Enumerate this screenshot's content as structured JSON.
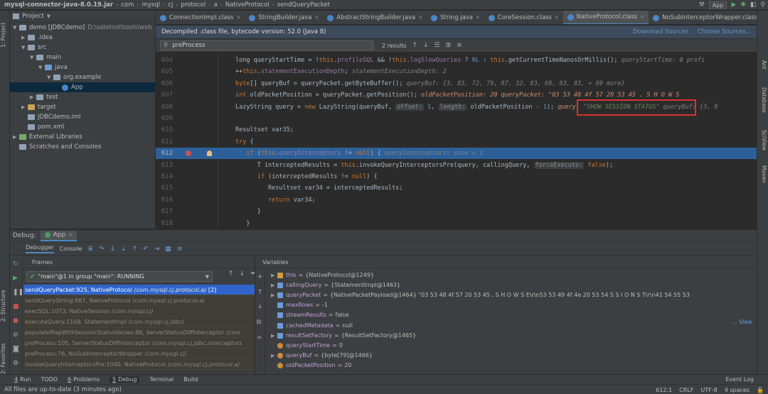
{
  "breadcrumbs": [
    "mysql-connector-java-8.0.19.jar",
    "com",
    "mysql",
    "cj",
    "protocol",
    "a",
    "NativeProtocol",
    "sendQueryPacket"
  ],
  "run_config": "App",
  "left_tabs": [
    "1: Project",
    "2: Structure",
    "2: Favorites"
  ],
  "right_tabs": [
    "Ant",
    "Database",
    "SciView",
    "Maven"
  ],
  "project": {
    "header": "Project",
    "tree": [
      {
        "label": "demo [JDBCdemo]",
        "extra": "D:\\satetool\\tools\\web",
        "depth": 0,
        "open": true,
        "kind": "module"
      },
      {
        "label": ".idea",
        "depth": 1,
        "open": false,
        "kind": "folder"
      },
      {
        "label": "src",
        "depth": 1,
        "open": true,
        "kind": "folder"
      },
      {
        "label": "main",
        "depth": 2,
        "open": true,
        "kind": "folder"
      },
      {
        "label": "java",
        "depth": 3,
        "open": true,
        "kind": "source"
      },
      {
        "label": "org.example",
        "depth": 4,
        "open": true,
        "kind": "package"
      },
      {
        "label": "App",
        "depth": 5,
        "open": null,
        "kind": "class",
        "selected": true
      },
      {
        "label": "test",
        "depth": 2,
        "open": false,
        "kind": "folder"
      },
      {
        "label": "target",
        "depth": 1,
        "open": false,
        "kind": "excluded"
      },
      {
        "label": "JDBCdemo.iml",
        "depth": 1,
        "open": null,
        "kind": "file"
      },
      {
        "label": "pom.xml",
        "depth": 1,
        "open": null,
        "kind": "file"
      },
      {
        "label": "External Libraries",
        "depth": 0,
        "open": false,
        "kind": "lib"
      },
      {
        "label": "Scratches and Consoles",
        "depth": 0,
        "open": null,
        "kind": "scratch"
      }
    ]
  },
  "editor_tabs": [
    {
      "label": "ConnectionImpl.class",
      "icon": "class-icon",
      "active": false
    },
    {
      "label": "StringBuilder.java",
      "icon": "class-icon",
      "active": false
    },
    {
      "label": "AbstractStringBuilder.java",
      "icon": "class-icon",
      "active": false
    },
    {
      "label": "String.java",
      "icon": "class-icon",
      "active": false
    },
    {
      "label": "CoreSession.class",
      "icon": "class-icon",
      "active": false
    },
    {
      "label": "NativeProtocol.class",
      "icon": "class-icon",
      "active": true
    },
    {
      "label": "NoSubInterceptorWrapper.class",
      "icon": "class-icon",
      "active": false
    }
  ],
  "banner": {
    "text": "Decompiled .class file, bytecode version: 52.0 (Java 8)",
    "download": "Download Sources",
    "choose": "Choose Sources..."
  },
  "find": {
    "value": "preProcess",
    "results": "2 results"
  },
  "code_lines": [
    {
      "num": "604",
      "html": "long queryStartTime = !<span class='kw'>this</span>.<span class='fld'>profileSQL</span> &amp;&amp; !<span class='kw'>this</span>.<span class='fld'>logSlowQueries</span> ? <span class='num'>0L</span> : <span class='kw'>this</span>.getCurrentTimeNanosOrMillis();   <span class='inl'>queryStartTime: 0  profi</span>"
    },
    {
      "num": "605",
      "html": "++<span class='kw'>this</span>.<span class='fld'>statementExecutionDepth</span>;  <span class='inl'>statementExecutionDepth: 2</span>"
    },
    {
      "num": "606",
      "html": "<span class='kw'>byte</span>[] queryBuf = queryPacket.getByteBuffer();  <span class='inl'>queryBuf: {3, 83, 72, 79, 87, 32, 83, 69, 83, 83, + 69 more}</span>"
    },
    {
      "num": "607",
      "html": "<span class='kw'>int</span> oldPacketPosition = queryPacket.getPosition();  <span class='inl2'>oldPacketPosition: 20  queryPacket: \"03 53 48 4f 57 20 53 45    . S H O W  S</span>"
    },
    {
      "num": "608",
      "html": "LazyString query = <span class='kw'>new</span> LazyString(queryBuf, <span class='hint'>offset:</span> <span class='num'>1</span>, <span class='hint'>length:</span> oldPacketPosition - <span class='num'>1</span>);  <span class='inl2'>query: </span><span class='strv'>\"SHOW SESSION STATUS\"</span>  <span class='inl'>  queryBuf: {3, 8</span>"
    },
    {
      "num": "609",
      "html": ""
    },
    {
      "num": "610",
      "html": "Resultset var35;"
    },
    {
      "num": "611",
      "html": "<span class='kw'>try</span> {"
    },
    {
      "num": "612",
      "html": "&nbsp;&nbsp;&nbsp;<span class='kw'>if</span> (<span class='kw'>this</span>.<span class='fld'>queryInterceptors</span> != <span class='kw'>null</span>) {  <span class='inl'>queryInterceptors:  size = 1</span>",
      "highlight": true
    },
    {
      "num": "613",
      "html": "&nbsp;&nbsp;&nbsp;&nbsp;&nbsp;&nbsp;T interceptedResults = <span class='kw'>this</span>.invokeQueryInterceptorsPre(query, callingQuery, <span class='hint'>forceExecute:</span> <span class='kw'>false</span>);"
    },
    {
      "num": "614",
      "html": "&nbsp;&nbsp;&nbsp;&nbsp;&nbsp;&nbsp;<span class='kw'>if</span> (interceptedResults != <span class='kw'>null</span>) {"
    },
    {
      "num": "615",
      "html": "&nbsp;&nbsp;&nbsp;&nbsp;&nbsp;&nbsp;&nbsp;&nbsp;&nbsp;Resultset var34 = interceptedResults;"
    },
    {
      "num": "616",
      "html": "&nbsp;&nbsp;&nbsp;&nbsp;&nbsp;&nbsp;&nbsp;&nbsp;&nbsp;<span class='kw'>return</span> var34;"
    },
    {
      "num": "617",
      "html": "&nbsp;&nbsp;&nbsp;&nbsp;&nbsp;&nbsp;}"
    },
    {
      "num": "618",
      "html": "&nbsp;&nbsp;&nbsp;}"
    }
  ],
  "debug": {
    "label": "Debug:",
    "app_tab": "App",
    "tabs": [
      "Debugger",
      "Console"
    ],
    "frames_header": "Frames",
    "variables_header": "Variables",
    "thread": "\"main\"@1 in group \"main\": RUNNING",
    "frames": [
      {
        "method": "sendQueryPacket:925, NativeProtocol",
        "cls": "(com.mysql.cj.protocol.a)",
        "suffix": " [2]",
        "selected": true
      },
      {
        "method": "sendQueryString:887, NativeProtocol",
        "cls": "(com.mysql.cj.protocol.a)",
        "suffix": ""
      },
      {
        "method": "execSQL:1073, NativeSession",
        "cls": "(com.mysql.cj)",
        "suffix": ""
      },
      {
        "method": "executeQuery:1168, StatementImpl",
        "cls": "(com.mysql.cj.jdbc)",
        "suffix": ""
      },
      {
        "method": "populateMapWithSessionStatusValues:86, ServerStatusDiffInterceptor",
        "cls": "(com",
        "suffix": ""
      },
      {
        "method": "preProcess:105, ServerStatusDiffInterceptor",
        "cls": "(com.mysql.cj.jdbc.interceptors",
        "suffix": ""
      },
      {
        "method": "preProcess:76, NoSubInterceptorWrapper",
        "cls": "(com.mysql.cj)",
        "suffix": ""
      },
      {
        "method": "invokeQueryInterceptorsPre:1040, NativeProtocol",
        "cls": "(com.mysql.cj.protocol.a)",
        "suffix": ""
      }
    ],
    "variables": [
      {
        "name": "this",
        "value": "{NativeProtocol@1249}",
        "expandable": true,
        "icon": "object"
      },
      {
        "name": "callingQuery",
        "value": "{StatementImpl@1463}",
        "expandable": true,
        "icon": "param"
      },
      {
        "name": "queryPacket",
        "value": "{NativePacketPayload@1464} \"03 53 48 4f 57 20 53 45      . S H O W   S E\\r\\n53 53 49 4f 4e 20 53 54      S S I O N   S T\\r\\n41 54 55 53",
        "expandable": true,
        "icon": "param"
      },
      {
        "name": "maxRows",
        "value": "-1",
        "expandable": false,
        "icon": "param"
      },
      {
        "name": "streamResults",
        "value": "false",
        "expandable": false,
        "icon": "param"
      },
      {
        "name": "cachedMetadata",
        "value": "null",
        "expandable": false,
        "icon": "param"
      },
      {
        "name": "resultSetFactory",
        "value": "{ResultSetFactory@1465}",
        "expandable": true,
        "icon": "param"
      },
      {
        "name": "queryStartTime",
        "value": "0",
        "expandable": false,
        "icon": "field"
      },
      {
        "name": "queryBuf",
        "value": "{byte[79]@1466}",
        "expandable": true,
        "icon": "field"
      },
      {
        "name": "oldPacketPosition",
        "value": "20",
        "expandable": false,
        "icon": "field"
      }
    ],
    "view_link": "... View"
  },
  "bottom_tools": [
    {
      "num": "4",
      "label": "Run",
      "active": false
    },
    {
      "num": "",
      "label": "TODO",
      "active": false
    },
    {
      "num": "6",
      "label": "Problems",
      "active": false
    },
    {
      "num": "5",
      "label": "Debug",
      "active": true
    },
    {
      "num": "",
      "label": "Terminal",
      "active": false
    },
    {
      "num": "",
      "label": "Build",
      "active": false
    }
  ],
  "event_log": "Event Log",
  "status": {
    "message": "All files are up-to-date (3 minutes ago)",
    "position": "612:1",
    "line_sep": "CRLF",
    "encoding": "UTF-8",
    "indent": "4 spaces"
  }
}
